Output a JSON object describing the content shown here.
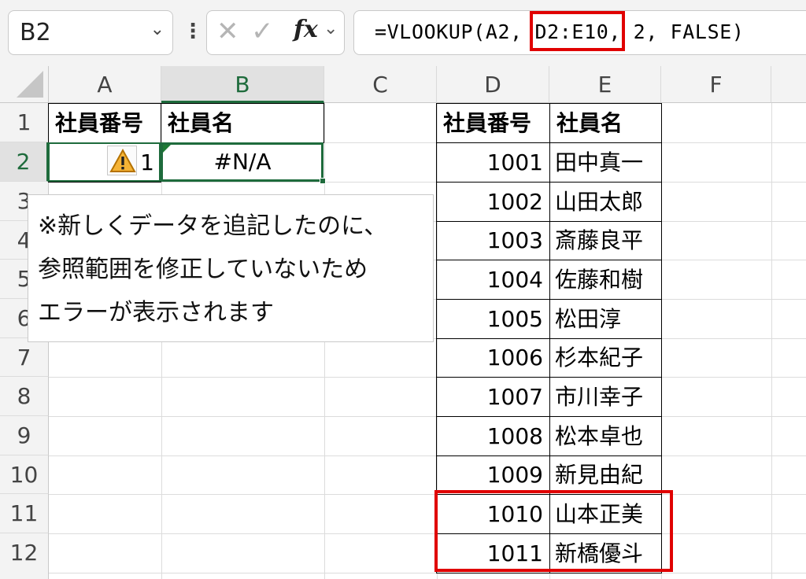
{
  "formula_bar": {
    "name_box": "B2",
    "fx_label": "fx",
    "cancel_glyph": "✕",
    "enter_glyph": "✓",
    "formula": "=VLOOKUP(A2, D2:E10, 2, FALSE)"
  },
  "grid": {
    "columns": [
      "A",
      "B",
      "C",
      "D",
      "E",
      "F"
    ],
    "rows": [
      "1",
      "2",
      "3",
      "4",
      "5",
      "6",
      "7",
      "8",
      "9",
      "10",
      "11",
      "12"
    ],
    "a1": "社員番号",
    "b1": "社員名",
    "a2_visible": "1",
    "b2": "#N/A",
    "lookup_table": {
      "headers": [
        "社員番号",
        "社員名"
      ],
      "rows": [
        [
          "1001",
          "田中真一"
        ],
        [
          "1002",
          "山田太郎"
        ],
        [
          "1003",
          "斎藤良平"
        ],
        [
          "1004",
          "佐藤和樹"
        ],
        [
          "1005",
          "松田淳"
        ],
        [
          "1006",
          "杉本紀子"
        ],
        [
          "1007",
          "市川幸子"
        ],
        [
          "1008",
          "松本卓也"
        ],
        [
          "1009",
          "新見由紀"
        ],
        [
          "1010",
          "山本正美"
        ],
        [
          "1011",
          "新橋優斗"
        ]
      ]
    }
  },
  "callout": {
    "line1": "※新しくデータを追記したのに、",
    "line2": "参照範囲を修正していないため",
    "line3": "エラーが表示されます"
  },
  "colors": {
    "accent": "#1e6b3c",
    "highlight": "#e00000",
    "warning": "#e8a317"
  }
}
